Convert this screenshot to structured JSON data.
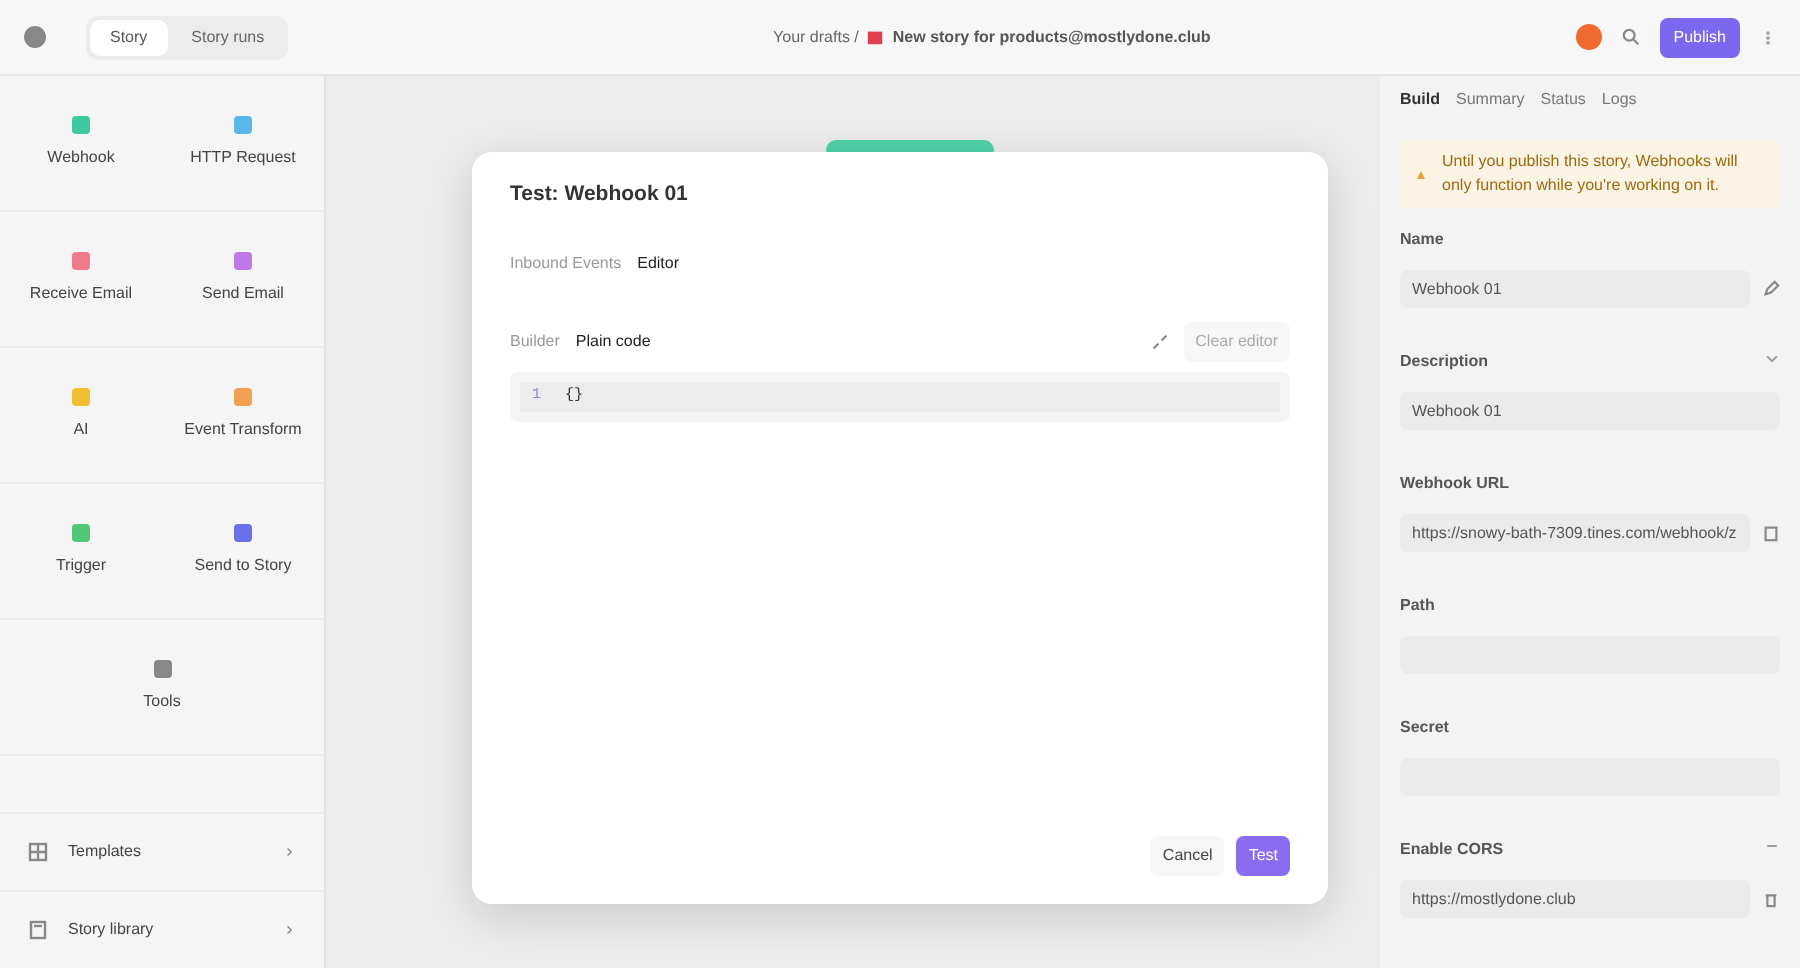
{
  "topbar": {
    "tabs": [
      {
        "label": "Story",
        "selected": true
      },
      {
        "label": "Story runs",
        "selected": false
      }
    ],
    "breadcrumb": "Your drafts /",
    "story_title": "New story for products@mostlydone.club",
    "publish": "Publish"
  },
  "sidebar": {
    "tools": [
      {
        "label": "Webhook",
        "color": "#3fc9a0"
      },
      {
        "label": "HTTP Request",
        "color": "#5ab8e8"
      },
      {
        "label": "Receive Email",
        "color": "#f07a8a"
      },
      {
        "label": "Send Email",
        "color": "#c07ae8"
      },
      {
        "label": "AI",
        "color": "#f0c030"
      },
      {
        "label": "Event Transform",
        "color": "#f0a050"
      },
      {
        "label": "Trigger",
        "color": "#50c878"
      },
      {
        "label": "Send to Story",
        "color": "#6a70e8"
      },
      {
        "label": "Tools",
        "color": "#888888"
      }
    ],
    "links": [
      {
        "label": "Templates"
      },
      {
        "label": "Story library"
      }
    ]
  },
  "panel": {
    "tabs": [
      {
        "label": "Build",
        "selected": true
      },
      {
        "label": "Summary",
        "selected": false
      },
      {
        "label": "Status",
        "selected": false
      },
      {
        "label": "Logs",
        "selected": false
      }
    ],
    "warning": "Until you publish this story, Webhooks will only function while you're working on it.",
    "fields": [
      {
        "label": "Name",
        "value": "Webhook 01"
      },
      {
        "label": "Description",
        "value": "Webhook 01"
      },
      {
        "label": "Webhook URL",
        "value": "https://snowy-bath-7309.tines.com/webhook/z"
      },
      {
        "label": "Path"
      },
      {
        "label": "Secret"
      },
      {
        "label": "Enable CORS",
        "value": "https://mostlydone.club"
      }
    ]
  },
  "modal": {
    "title": "Test: Webhook 01",
    "tabs": [
      {
        "label": "Inbound Events",
        "selected": false
      },
      {
        "label": "Editor",
        "selected": true
      }
    ],
    "mode_tabs": [
      {
        "label": "Builder",
        "selected": false
      },
      {
        "label": "Plain code",
        "selected": true
      }
    ],
    "clear": "Clear editor",
    "lines": [
      {
        "number": "1",
        "code": "{}"
      }
    ],
    "cancel": "Cancel",
    "submit": "Test"
  }
}
